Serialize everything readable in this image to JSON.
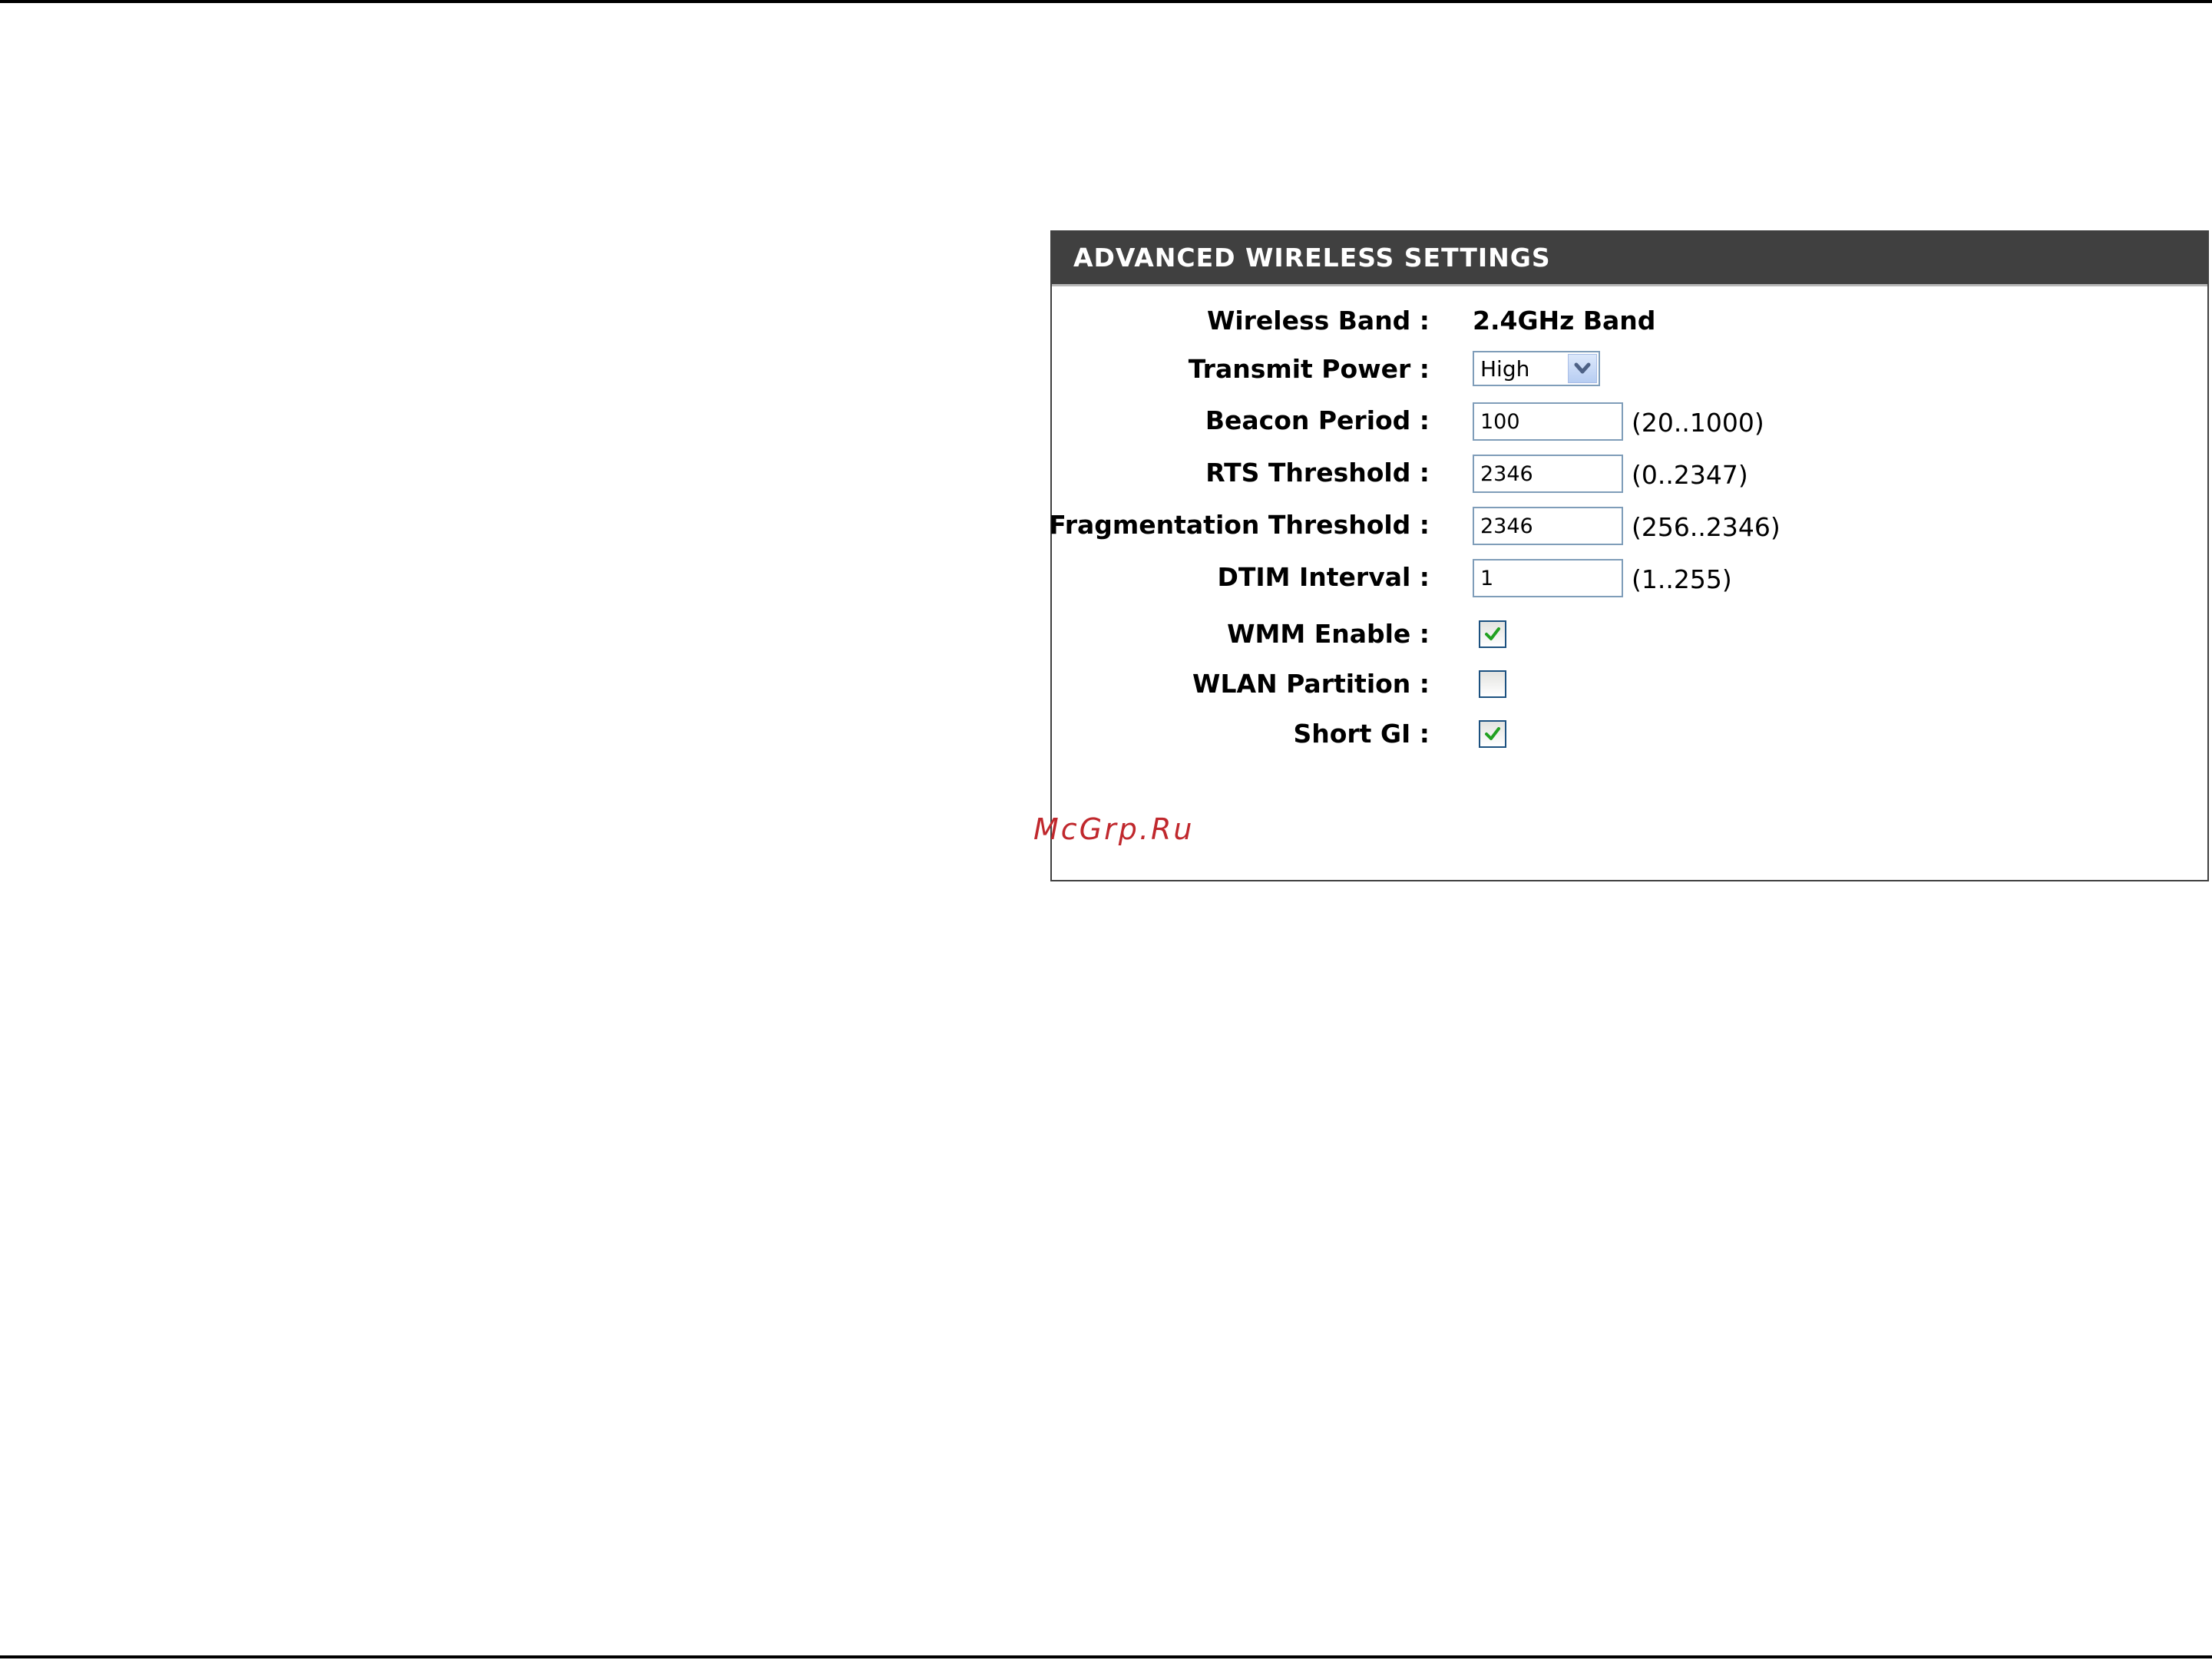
{
  "panel": {
    "title": "ADVANCED WIRELESS SETTINGS"
  },
  "fields": {
    "wireless_band": {
      "label": "Wireless Band :",
      "value": "2.4GHz Band"
    },
    "transmit_power": {
      "label": "Transmit Power :",
      "selected": "High",
      "icon": "chevron-down-icon"
    },
    "beacon_period": {
      "label": "Beacon Period :",
      "value": "100",
      "range": "(20..1000)"
    },
    "rts_threshold": {
      "label": "RTS Threshold :",
      "value": "2346",
      "range": "(0..2347)"
    },
    "fragmentation_threshold": {
      "label": "Fragmentation Threshold :",
      "value": "2346",
      "range": "(256..2346)"
    },
    "dtim_interval": {
      "label": "DTIM Interval :",
      "value": "1",
      "range": "(1..255)"
    },
    "wmm_enable": {
      "label": "WMM Enable :",
      "checked": true
    },
    "wlan_partition": {
      "label": "WLAN Partition :",
      "checked": false
    },
    "short_gi": {
      "label": "Short GI :",
      "checked": true
    }
  },
  "watermark": "McGrp.Ru",
  "colors": {
    "header_bg": "#404040",
    "input_border": "#7f9db9",
    "check_color": "#21a121",
    "watermark": "#c0282d"
  }
}
